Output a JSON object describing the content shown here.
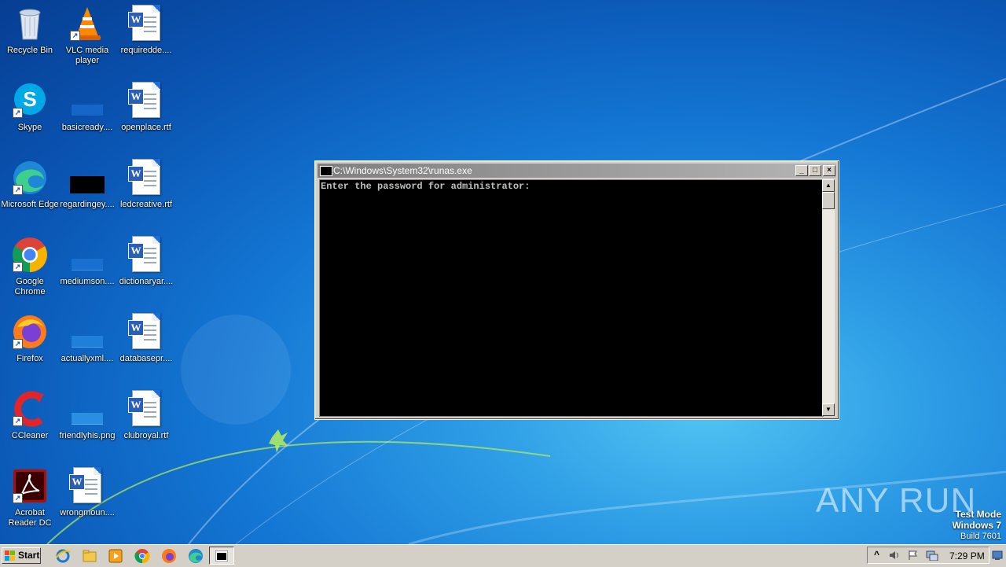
{
  "desktop": {
    "icons": [
      {
        "label": "Recycle Bin",
        "icon": "recycle-bin-icon"
      },
      {
        "label": "VLC media player",
        "icon": "vlc-icon"
      },
      {
        "label": "requiredde....",
        "icon": "word-document-icon"
      },
      {
        "label": "Skype",
        "icon": "skype-icon"
      },
      {
        "label": "basicready....",
        "icon": "image-file-icon"
      },
      {
        "label": "openplace.rtf",
        "icon": "word-document-icon"
      },
      {
        "label": "Microsoft Edge",
        "icon": "edge-icon"
      },
      {
        "label": "regardingey....",
        "icon": "image-file-icon"
      },
      {
        "label": "ledcreative.rtf",
        "icon": "word-document-icon"
      },
      {
        "label": "Google Chrome",
        "icon": "chrome-icon"
      },
      {
        "label": "mediumson....",
        "icon": "image-file-icon"
      },
      {
        "label": "dictionaryar....",
        "icon": "word-document-icon"
      },
      {
        "label": "Firefox",
        "icon": "firefox-icon"
      },
      {
        "label": "actuallyxml....",
        "icon": "image-file-icon"
      },
      {
        "label": "databasepr....",
        "icon": "word-document-icon"
      },
      {
        "label": "CCleaner",
        "icon": "ccleaner-icon"
      },
      {
        "label": "friendlyhis.png",
        "icon": "image-file-icon"
      },
      {
        "label": "clubroyal.rtf",
        "icon": "word-document-icon"
      },
      {
        "label": "Acrobat Reader DC",
        "icon": "acrobat-icon"
      },
      {
        "label": "wrongmoun....",
        "icon": "word-document-icon"
      }
    ]
  },
  "console_window": {
    "title": "C:\\Windows\\System32\\runas.exe",
    "output": "Enter the password for administrator:",
    "minimize_symbol": "_",
    "maximize_symbol": "□",
    "close_symbol": "×",
    "scroll_up_symbol": "▲",
    "scroll_down_symbol": "▼"
  },
  "watermark": {
    "brand": "ANY RUN",
    "mode": "Test Mode",
    "os": "Windows 7",
    "build": "Build 7601"
  },
  "taskbar": {
    "start_label": "Start",
    "pinned": [
      "internet-explorer-icon",
      "explorer-folder-icon",
      "media-player-icon",
      "chrome-icon",
      "firefox-icon",
      "edge-icon"
    ],
    "active_task": "console-window-icon",
    "tray_expand_symbol": "^",
    "clock": "7:29 PM"
  },
  "colors": {
    "desktop_bg": "#1477d4",
    "console_bg": "#000000",
    "console_text": "#c0c0c0",
    "titlebar_inactive": "#7f7f7f",
    "taskbar_bg": "#d4d0c8"
  }
}
